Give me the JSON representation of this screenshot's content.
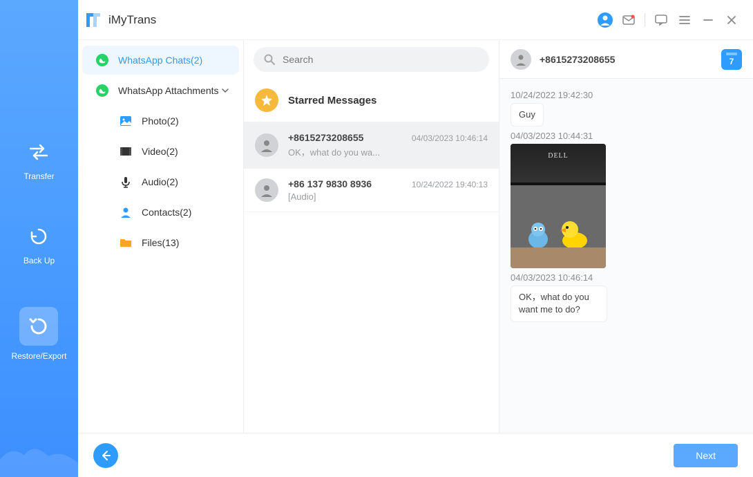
{
  "app": {
    "name": "iMyTrans"
  },
  "topbar": {
    "icons": {
      "user": "user-icon",
      "mail": "mail-icon",
      "chat": "chat-icon",
      "menu": "menu-icon",
      "min": "minimize-icon",
      "close": "close-icon"
    }
  },
  "leftNav": {
    "items": [
      {
        "key": "transfer",
        "label": "Transfer"
      },
      {
        "key": "backup",
        "label": "Back Up"
      },
      {
        "key": "restore",
        "label": "Restore/Export"
      }
    ],
    "activeKey": "restore"
  },
  "sidebar": {
    "chats": {
      "label": "WhatsApp Chats(2)"
    },
    "attachments": {
      "label": "WhatsApp Attachments"
    },
    "children": [
      {
        "key": "photo",
        "label": "Photo(2)"
      },
      {
        "key": "video",
        "label": "Video(2)"
      },
      {
        "key": "audio",
        "label": "Audio(2)"
      },
      {
        "key": "contacts",
        "label": "Contacts(2)"
      },
      {
        "key": "files",
        "label": "Files(13)"
      }
    ]
  },
  "search": {
    "placeholder": "Search"
  },
  "starred": {
    "label": "Starred Messages"
  },
  "chats": [
    {
      "name": "+8615273208655",
      "time": "04/03/2023 10:46:14",
      "preview": "OK，what do you wa..."
    },
    {
      "name": "+86 137 9830 8936",
      "time": "10/24/2022 19:40:13",
      "preview": "[Audio]"
    }
  ],
  "detail": {
    "contact": "+8615273208655",
    "calendarDay": "7",
    "messages": [
      {
        "ts": "10/24/2022 19:42:30",
        "type": "text",
        "text": "Guy"
      },
      {
        "ts": "04/03/2023 10:44:31",
        "type": "image",
        "monitorBrand": "DELL"
      },
      {
        "ts": "04/03/2023 10:46:14",
        "type": "text",
        "text": "OK，what do you want me to do?"
      }
    ]
  },
  "footer": {
    "next": "Next"
  }
}
